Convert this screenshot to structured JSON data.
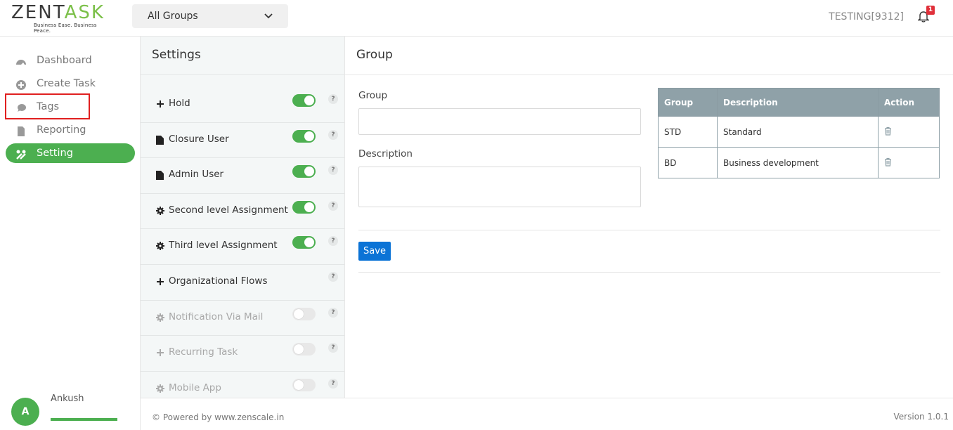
{
  "brand": {
    "logo_text_left": "ZENT",
    "logo_text_accent": "A",
    "logo_text_right": "SK",
    "tagline": "Business Ease. Business Peace."
  },
  "header": {
    "group_selector": "All Groups",
    "user_code": "TESTING[9312]",
    "notification_count": "1"
  },
  "sidebar": {
    "items": [
      {
        "label": "Dashboard",
        "icon": "dashboard-icon"
      },
      {
        "label": "Create Task",
        "icon": "plus-circle-icon"
      },
      {
        "label": "Tags",
        "icon": "tag-bubble-icon"
      },
      {
        "label": "Reporting",
        "icon": "document-icon"
      },
      {
        "label": "Setting",
        "icon": "tools-icon",
        "active": true
      }
    ],
    "user": {
      "initial": "A",
      "name": "Ankush"
    }
  },
  "settings": {
    "title": "Settings",
    "items": [
      {
        "label": "Hold",
        "icon": "plus-icon",
        "toggle": true,
        "enabled": true
      },
      {
        "label": "Closure User",
        "icon": "file-icon",
        "toggle": true,
        "enabled": true
      },
      {
        "label": "Admin User",
        "icon": "file-icon",
        "toggle": true,
        "enabled": true
      },
      {
        "label": "Second level Assignment",
        "icon": "gear-icon",
        "toggle": true,
        "enabled": true
      },
      {
        "label": "Third level Assignment",
        "icon": "gear-icon",
        "toggle": true,
        "enabled": true
      },
      {
        "label": "Organizational Flows",
        "icon": "plus-icon",
        "toggle": null,
        "enabled": true
      },
      {
        "label": "Notification Via Mail",
        "icon": "gear-icon",
        "toggle": false,
        "enabled": false
      },
      {
        "label": "Recurring Task",
        "icon": "plus-icon",
        "toggle": false,
        "enabled": false
      },
      {
        "label": "Mobile App",
        "icon": "gear-icon",
        "toggle": false,
        "enabled": false
      }
    ],
    "help_symbol": "?"
  },
  "main": {
    "title": "Group",
    "form": {
      "group_label": "Group",
      "group_value": "",
      "description_label": "Description",
      "description_value": "",
      "save_label": "Save"
    },
    "table": {
      "headers": [
        "Group",
        "Description",
        "Action"
      ],
      "rows": [
        {
          "group": "STD",
          "description": "Standard"
        },
        {
          "group": "BD",
          "description": "Business development"
        }
      ]
    }
  },
  "footer": {
    "powered": "© Powered by www.zenscale.in",
    "version": "Version 1.0.1"
  },
  "colors": {
    "accent_green": "#4caf50",
    "save_blue": "#0b73d6",
    "table_header": "#8fa1a8",
    "highlight_red": "#e02020",
    "badge_red": "#e0303a"
  }
}
